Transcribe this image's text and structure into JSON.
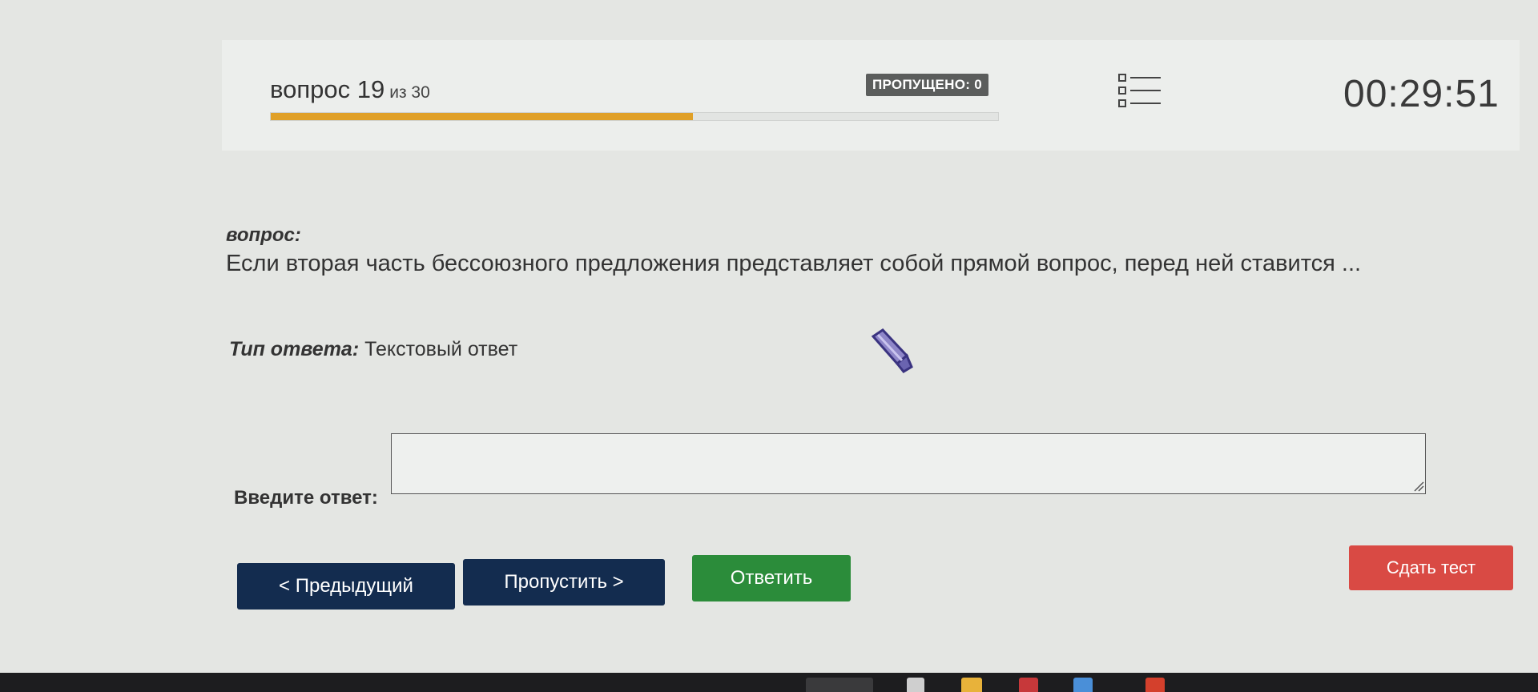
{
  "header": {
    "question_word": "вопрос 19",
    "question_of": "из 30",
    "progress": 0.58,
    "skipped_badge": "ПРОПУЩЕНО: 0",
    "list_icon": "list-icon",
    "timer": "00:29:51"
  },
  "question": {
    "title": "вопрос:",
    "text": "Если вторая часть бессоюзного предложения представляет собой прямой вопрос, перед ней ставится ..."
  },
  "answer_type": {
    "label": "Тип ответа:",
    "value": "Текстовый ответ"
  },
  "answer": {
    "label": "Введите ответ:",
    "value": ""
  },
  "buttons": {
    "prev": "< Предыдущий",
    "skip": "Пропустить >",
    "answer": "Ответить",
    "finish": "Сдать тест"
  },
  "colors": {
    "progress": "#e0a028",
    "nav_button": "#132c4f",
    "answer_button": "#2b8c3a",
    "finish_button": "#d94a44"
  }
}
